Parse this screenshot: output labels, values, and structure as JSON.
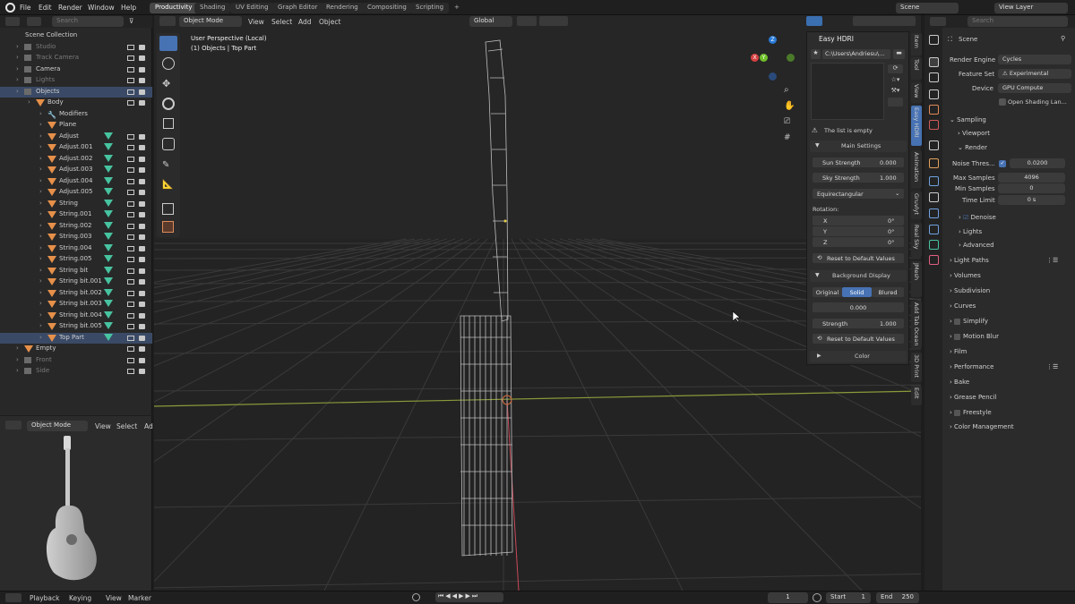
{
  "topbar": {
    "menus": [
      "File",
      "Edit",
      "Render",
      "Window",
      "Help"
    ],
    "workspaces": [
      "Productivity",
      "Shading",
      "UV Editing",
      "Graph Editor",
      "Rendering",
      "Compositing",
      "Scripting"
    ],
    "active_workspace": "Productivity",
    "scene": "Scene",
    "view_layer": "View Layer"
  },
  "outliner": {
    "search_placeholder": "Search",
    "root": "Scene Collection",
    "items": [
      {
        "label": "Studio",
        "dim": true
      },
      {
        "label": "Track Camera",
        "dim": true
      },
      {
        "label": "Camera",
        "dim": false
      },
      {
        "label": "Lights",
        "dim": true
      },
      {
        "label": "Objects",
        "dim": false
      },
      {
        "label": "Body",
        "dim": false
      },
      {
        "label": "Modifiers",
        "dim": false
      },
      {
        "label": "Plane",
        "dim": false
      },
      {
        "label": "Adjust",
        "dim": false
      },
      {
        "label": "Adjust.001",
        "dim": false
      },
      {
        "label": "Adjust.002",
        "dim": false
      },
      {
        "label": "Adjust.003",
        "dim": false
      },
      {
        "label": "Adjust.004",
        "dim": false
      },
      {
        "label": "Adjust.005",
        "dim": false
      },
      {
        "label": "String",
        "dim": false
      },
      {
        "label": "String.001",
        "dim": false
      },
      {
        "label": "String.002",
        "dim": false
      },
      {
        "label": "String.003",
        "dim": false
      },
      {
        "label": "String.004",
        "dim": false
      },
      {
        "label": "String.005",
        "dim": false
      },
      {
        "label": "String bit",
        "dim": false
      },
      {
        "label": "String bit.001",
        "dim": false
      },
      {
        "label": "String bit.002",
        "dim": false
      },
      {
        "label": "String bit.003",
        "dim": false
      },
      {
        "label": "String bit.004",
        "dim": false
      },
      {
        "label": "String bit.005",
        "dim": false
      },
      {
        "label": "Top Part",
        "dim": false
      },
      {
        "label": "Empty",
        "dim": false
      },
      {
        "label": "Front",
        "dim": true
      },
      {
        "label": "Side",
        "dim": true
      }
    ]
  },
  "thumb_header": {
    "mode": "Object Mode",
    "view": "View",
    "select": "Select",
    "add": "Ad"
  },
  "viewport": {
    "mode": "Object Mode",
    "menus": [
      "View",
      "Select",
      "Add",
      "Object"
    ],
    "orientation": "Global",
    "info_line1": "User Perspective (Local)",
    "info_line2": "(1) Objects | Top Part",
    "gizmo_axes": {
      "x": "X",
      "y": "Y",
      "z": "Z"
    }
  },
  "easy_hdri": {
    "title": "Easy HDRI",
    "path": "C:\\Users\\Andriesu\\...",
    "empty_msg": "The list is empty",
    "main_settings": "Main Settings",
    "sun_strength_label": "Sun Strength",
    "sun_strength": "0.000",
    "sky_strength_label": "Sky Strength",
    "sky_strength": "1.000",
    "projection": "Equirectangular",
    "rotation_label": "Rotation:",
    "rot": [
      {
        "axis": "X",
        "val": "0°"
      },
      {
        "axis": "Y",
        "val": "0°"
      },
      {
        "axis": "Z",
        "val": "0°"
      }
    ],
    "reset": "Reset to Default Values",
    "bg_display": "Background Display",
    "bg_tabs": [
      "Original",
      "Solid",
      "Blured"
    ],
    "bg_value": "0.000",
    "strength_label": "Strength",
    "strength": "1.000",
    "reset2": "Reset to Default Values",
    "color": "Color"
  },
  "side_tabs": [
    "Item",
    "Tool",
    "View",
    "Easy HDRI",
    "Animation",
    "Gruvlyt",
    "Real Sky",
    "JMesh",
    "Add Tab Ocean",
    "3D Print",
    "Edit"
  ],
  "properties": {
    "search_placeholder": "Search",
    "header": "Scene",
    "render_engine_label": "Render Engine",
    "render_engine": "Cycles",
    "feature_set_label": "Feature Set",
    "feature_set": "Experimental",
    "device_label": "Device",
    "device": "GPU Compute",
    "osl": "Open Shading Lan...",
    "sampling": "Sampling",
    "viewport": "Viewport",
    "render": "Render",
    "noise_label": "Noise Thres...",
    "noise": "0.0200",
    "max_samples_label": "Max Samples",
    "max_samples": "4096",
    "min_samples_label": "Min Samples",
    "min_samples": "0",
    "time_limit_label": "Time Limit",
    "time_limit": "0 s",
    "denoise": "Denoise",
    "lights": "Lights",
    "advanced": "Advanced",
    "panels": [
      "Light Paths",
      "Volumes",
      "Subdivision",
      "Curves",
      "Simplify",
      "Motion Blur",
      "Film",
      "Performance",
      "Bake",
      "Grease Pencil",
      "Freestyle",
      "Color Management"
    ]
  },
  "timeline": {
    "menus": [
      "Playback",
      "Keying",
      "View",
      "Marker"
    ],
    "current_frame": "1",
    "start_label": "Start",
    "start": "1",
    "end_label": "End",
    "end": "250"
  }
}
